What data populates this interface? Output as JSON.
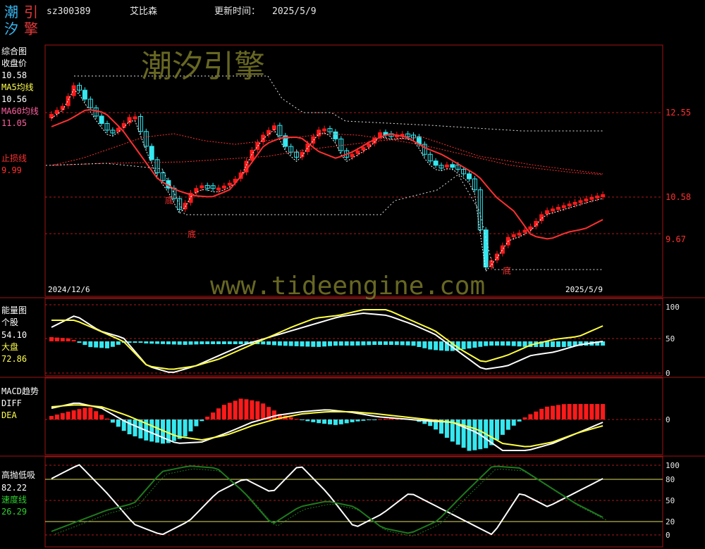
{
  "header": {
    "logo_chars": [
      "潮",
      "引",
      "汐",
      "擎"
    ],
    "code": "sz300389",
    "name": "艾比森",
    "update_label": "更新时间：",
    "update_date": "2025/5/9"
  },
  "watermark": {
    "logo_text": "潮汐引擎",
    "url": "www.tideengine.com"
  },
  "main_panel": {
    "title": "综合图",
    "close_label": "收盘价",
    "close_value": "10.58",
    "ma5_label": "MA5均线",
    "ma5_value": "10.56",
    "ma60_label": "MA60均线",
    "ma60_value": "11.05",
    "stop_label": "止损线",
    "stop_value": "9.99",
    "axis_ticks": [
      "12.55",
      "10.58",
      "9.67"
    ],
    "date_start": "2024/12/6",
    "date_end": "2025/5/9",
    "bottom_marks": [
      "底",
      "底",
      "底"
    ]
  },
  "energy_panel": {
    "title": "能量图",
    "stock_label": "个股",
    "stock_value": "54.10",
    "market_label": "大盘",
    "market_value": "72.86",
    "axis_ticks": [
      "100",
      "50",
      "0"
    ]
  },
  "macd_panel": {
    "title": "MACD趋势",
    "diff_label": "DIFF",
    "dea_label": "DEA",
    "axis_ticks": [
      "0"
    ]
  },
  "gdxq_panel": {
    "title": "高抛低吸",
    "value": "82.22",
    "speed_label": "速度线",
    "speed_value": "26.29",
    "axis_ticks": [
      "100",
      "80",
      "50",
      "20",
      "0"
    ]
  },
  "colors": {
    "up": "#ff1a1a",
    "down": "#35e8f0",
    "ma5": "#ffffff",
    "ma60": "#ff3030",
    "stop": "#e0e0e0",
    "grid": "#8b1010",
    "yellow": "#ffff40",
    "green": "#1e7a1e"
  }
}
